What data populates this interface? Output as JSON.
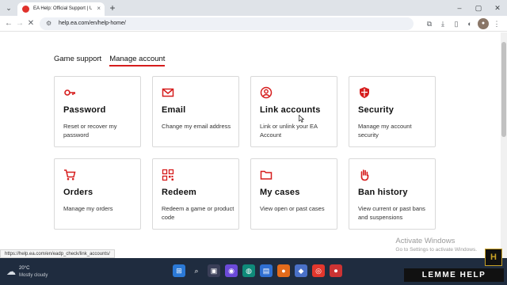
{
  "browser": {
    "tab_title": "EA Help: Official Support | Unit",
    "tab_close": "×",
    "new_tab": "+",
    "url": "help.ea.com/en/help-home/",
    "win_min": "–",
    "win_max": "▢",
    "win_close": "✕"
  },
  "page": {
    "subnav": {
      "game_support": "Game support",
      "manage_account": "Manage account"
    },
    "cards": [
      {
        "title": "Password",
        "desc": "Reset or recover my password",
        "icon": "key-icon"
      },
      {
        "title": "Email",
        "desc": "Change my email address",
        "icon": "envelope-icon"
      },
      {
        "title": "Link accounts",
        "desc": "Link or unlink your EA Account",
        "icon": "user-circle-icon"
      },
      {
        "title": "Security",
        "desc": "Manage my account security",
        "icon": "shield-icon"
      },
      {
        "title": "Orders",
        "desc": "Manage my orders",
        "icon": "cart-icon"
      },
      {
        "title": "Redeem",
        "desc": "Redeem a game or product code",
        "icon": "qr-code-icon"
      },
      {
        "title": "My cases",
        "desc": "View open or past cases",
        "icon": "folder-icon"
      },
      {
        "title": "Ban history",
        "desc": "View current or past bans and suspensions",
        "icon": "hand-icon"
      }
    ],
    "status_url": "https://help.ea.com/en/eadp_check/link_accounts/"
  },
  "watermark": {
    "title": "Activate Windows",
    "subtitle": "Go to Settings to activate Windows."
  },
  "taskbar": {
    "temperature": "20°C",
    "condition": "Mostly cloudy"
  },
  "overlay": {
    "banner": "LEMME HELP",
    "logo": "H"
  },
  "colors": {
    "accent": "#d61d1d",
    "taskbar": "#1f2c3f"
  }
}
